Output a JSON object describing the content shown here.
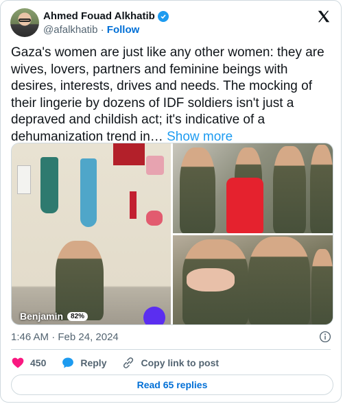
{
  "author": {
    "name": "Ahmed Fouad Alkhatib",
    "handle": "@afalkhatib",
    "separator": "·",
    "follow_label": "Follow"
  },
  "tweet": {
    "text": "Gaza's women are just like any other women: they are wives, lovers, partners and feminine beings with desires, interests, drives and needs. The mocking of their lingerie by dozens of IDF soldiers isn't just a depraved and childish act; it's indicative of a dehumanization trend in…",
    "show_more": "Show more"
  },
  "media": {
    "photo1_caption": "Benjamin",
    "photo1_badge": "82%"
  },
  "meta": {
    "timestamp": "1:46 AM · Feb 24, 2024"
  },
  "actions": {
    "like_count": "450",
    "reply_label": "Reply",
    "copy_label": "Copy link to post"
  },
  "replies": {
    "label": "Read 65 replies"
  },
  "colors": {
    "accent": "#1d9bf0",
    "link": "#006fd6",
    "like": "#f91880",
    "muted": "#536471"
  },
  "icons": [
    "verified-badge-icon",
    "x-logo-icon",
    "info-icon",
    "heart-icon",
    "reply-bubble-icon",
    "link-icon"
  ]
}
